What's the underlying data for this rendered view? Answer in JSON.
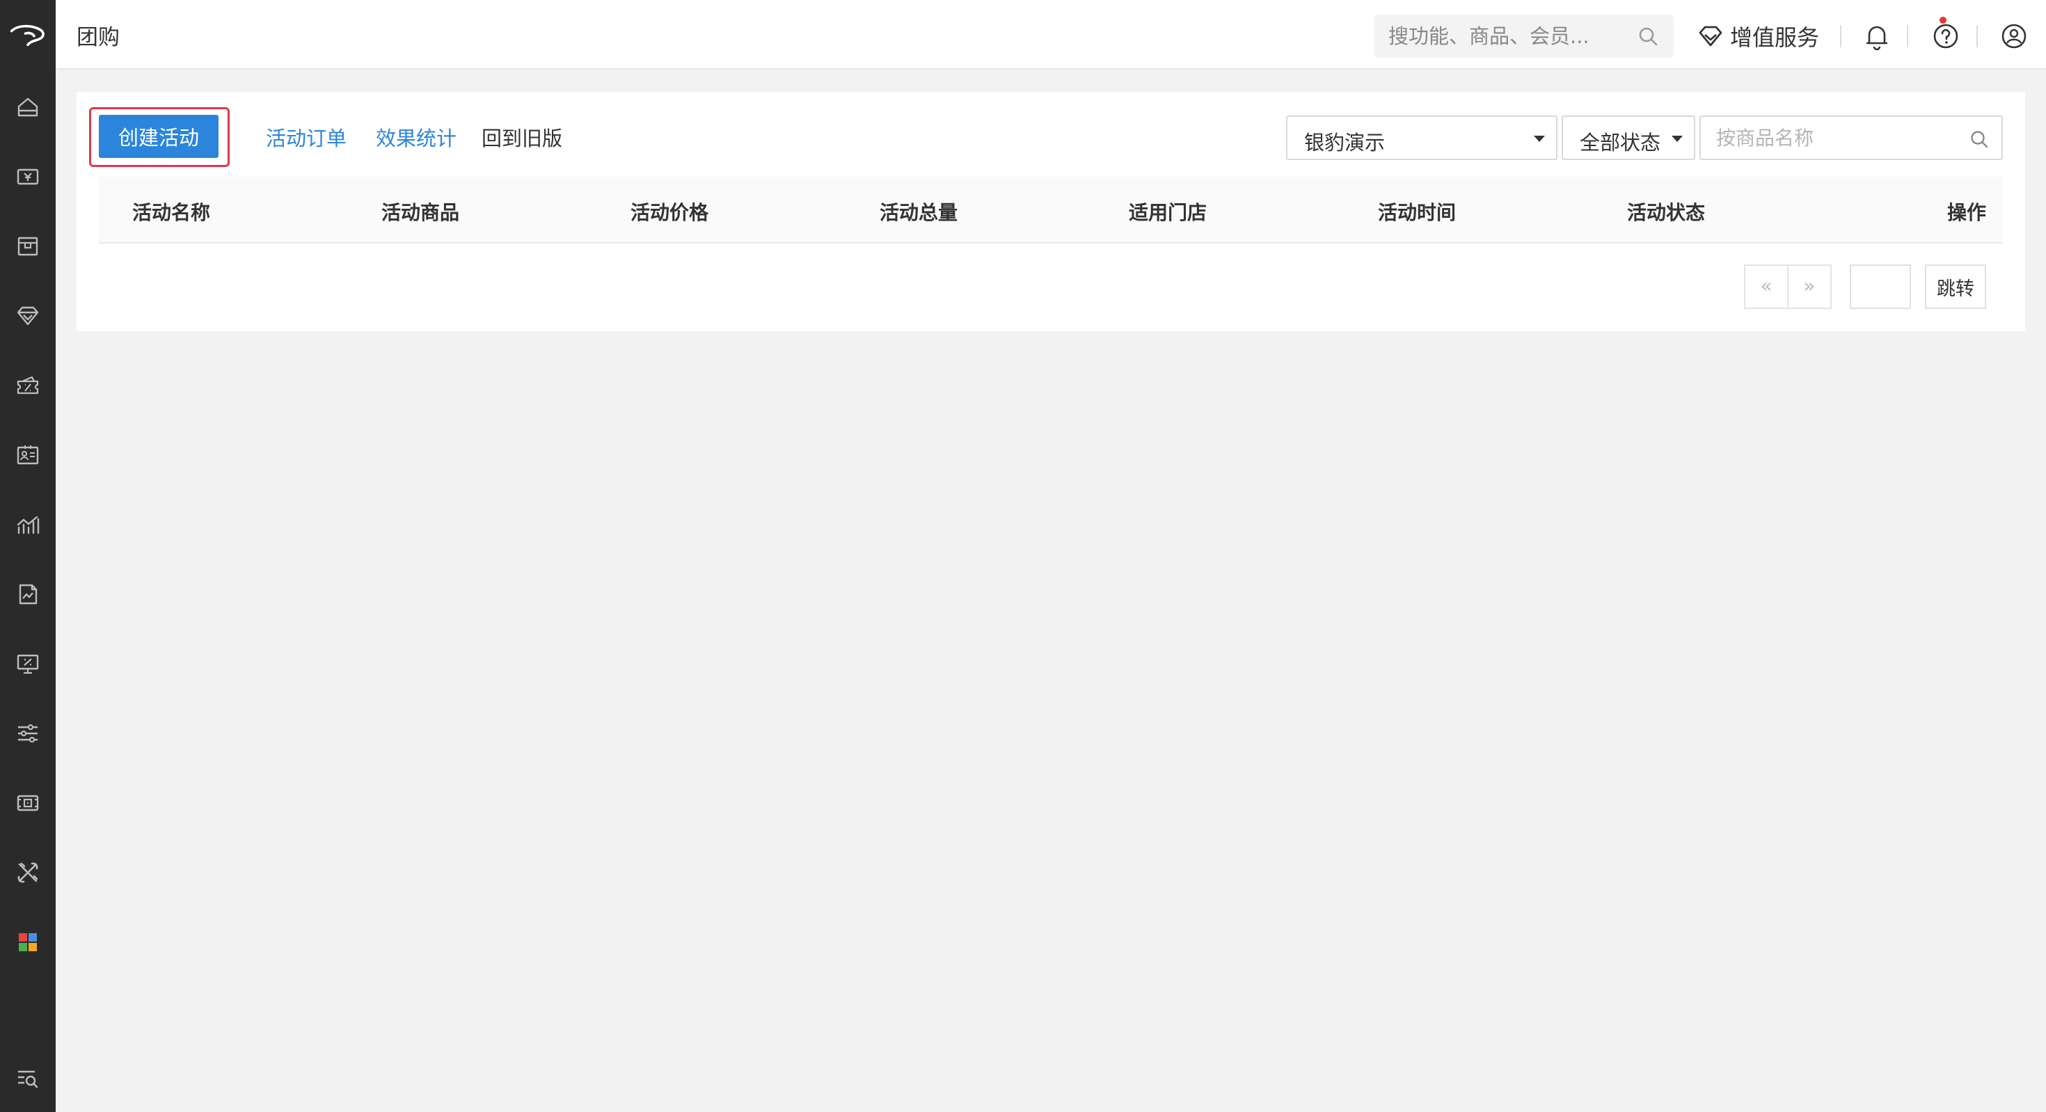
{
  "header": {
    "page_title": "团购",
    "search_placeholder": "搜功能、商品、会员...",
    "value_service_label": "增值服务"
  },
  "sidebar": {
    "items": [
      {
        "icon": "home-icon"
      },
      {
        "icon": "cashier-icon"
      },
      {
        "icon": "goods-icon"
      },
      {
        "icon": "member-icon"
      },
      {
        "icon": "marketing-icon"
      },
      {
        "icon": "staff-icon"
      },
      {
        "icon": "report-icon"
      },
      {
        "icon": "finance-icon"
      },
      {
        "icon": "promotion-screen-icon"
      },
      {
        "icon": "settings-icon"
      },
      {
        "icon": "device-icon"
      },
      {
        "icon": "tools-icon"
      },
      {
        "icon": "apps-icon"
      },
      {
        "icon": "search-menu-icon"
      }
    ]
  },
  "toolbar": {
    "create_label": "创建活动",
    "tabs": [
      {
        "label": "活动订单"
      },
      {
        "label": "效果统计"
      },
      {
        "label": "回到旧版"
      }
    ],
    "store_select": "银豹演示",
    "status_select": "全部状态",
    "name_search_placeholder": "按商品名称"
  },
  "table": {
    "columns": [
      "活动名称",
      "活动商品",
      "活动价格",
      "活动总量",
      "适用门店",
      "活动时间",
      "活动状态",
      "操作"
    ],
    "rows": []
  },
  "pagination": {
    "prev": "«",
    "next": "»",
    "page_value": "",
    "jump_label": "跳转"
  },
  "colors": {
    "primary": "#2c85db",
    "sidebar_bg": "#2a2a2a",
    "highlight": "#e2364e",
    "notify": "#e53935"
  }
}
